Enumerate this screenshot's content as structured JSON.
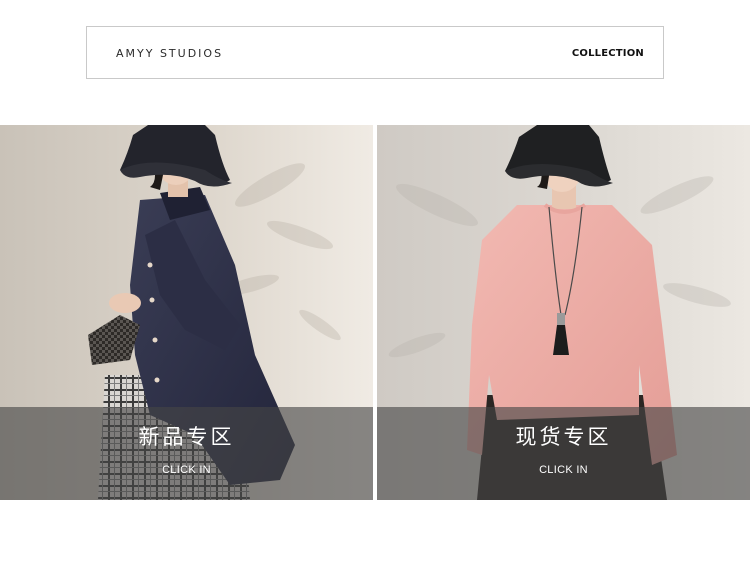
{
  "header": {
    "brand": "AMYY STUDIOS",
    "collection_label": "COLLECTION"
  },
  "panels": [
    {
      "title": "新品专区",
      "subtitle": "CLICK IN",
      "image_subject": "woman in navy bucket hat and sheer navy shirt with plaid skirt holding woven clutch"
    },
    {
      "title": "现货专区",
      "subtitle": "CLICK IN",
      "image_subject": "woman in black bucket hat and pink knit sweater with long pendant necklace"
    }
  ],
  "colors": {
    "caption_overlay": "#464646",
    "header_border": "#c9c9c9",
    "text_dark": "#111111"
  }
}
